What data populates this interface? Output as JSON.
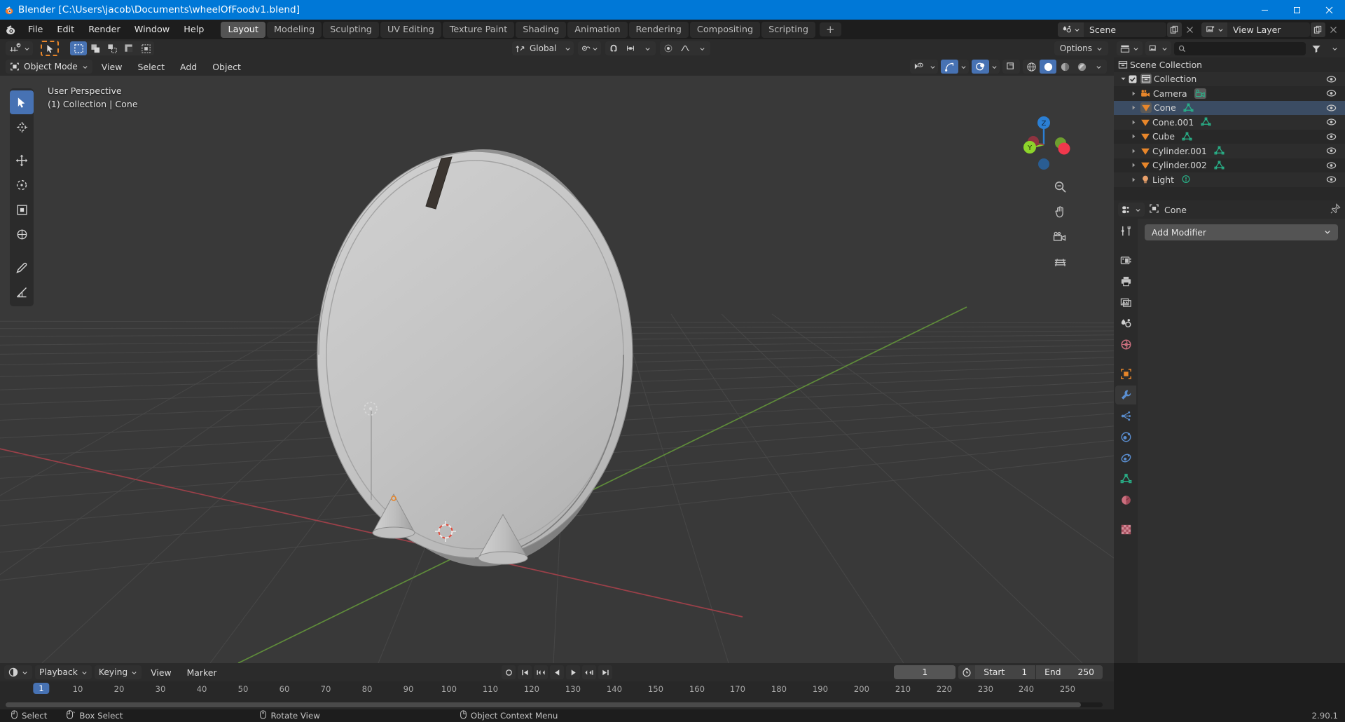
{
  "window": {
    "title": "Blender [C:\\Users\\jacob\\Documents\\wheelOfFoodv1.blend]",
    "minimize": "─",
    "maximize": "☐",
    "close": "✕"
  },
  "topbar": {
    "menus": [
      "File",
      "Edit",
      "Render",
      "Window",
      "Help"
    ],
    "workspaces": [
      {
        "label": "Layout",
        "active": true
      },
      {
        "label": "Modeling",
        "active": false
      },
      {
        "label": "Sculpting",
        "active": false
      },
      {
        "label": "UV Editing",
        "active": false
      },
      {
        "label": "Texture Paint",
        "active": false
      },
      {
        "label": "Shading",
        "active": false
      },
      {
        "label": "Animation",
        "active": false
      },
      {
        "label": "Rendering",
        "active": false
      },
      {
        "label": "Compositing",
        "active": false
      },
      {
        "label": "Scripting",
        "active": false
      }
    ],
    "add_workspace": "+",
    "scene_name": "Scene",
    "view_layer_name": "View Layer"
  },
  "viewport": {
    "orientation_label": "Global",
    "options_label": "Options",
    "mode_label": "Object Mode",
    "header_menus": [
      "View",
      "Select",
      "Add",
      "Object"
    ],
    "overlay_line1": "User Perspective",
    "overlay_line2": "(1) Collection | Cone",
    "gizmo_axes": [
      {
        "label": "Z",
        "color": "#2b7fd4"
      },
      {
        "label": "Y",
        "color": "#8dd42b"
      },
      {
        "label": "X",
        "color": "#d4354a"
      }
    ]
  },
  "outliner": {
    "display_mode": "View Layer",
    "search_placeholder": "",
    "root": "Scene Collection",
    "items": [
      {
        "name": "Collection",
        "type": "collection",
        "indent": 1,
        "checkbox": true,
        "expanded": true,
        "selected": false
      },
      {
        "name": "Camera",
        "type": "camera",
        "indent": 2,
        "selected": false
      },
      {
        "name": "Cone",
        "type": "mesh",
        "indent": 2,
        "selected": true
      },
      {
        "name": "Cone.001",
        "type": "mesh",
        "indent": 2,
        "selected": false
      },
      {
        "name": "Cube",
        "type": "mesh",
        "indent": 2,
        "selected": false
      },
      {
        "name": "Cylinder.001",
        "type": "mesh",
        "indent": 2,
        "selected": false
      },
      {
        "name": "Cylinder.002",
        "type": "mesh",
        "indent": 2,
        "selected": false
      },
      {
        "name": "Light",
        "type": "light",
        "indent": 2,
        "selected": false
      }
    ]
  },
  "properties": {
    "breadcrumb_object": "Cone",
    "add_modifier_label": "Add Modifier",
    "tabs": [
      {
        "name": "tool",
        "active": false
      },
      {
        "name": "render",
        "active": false
      },
      {
        "name": "output",
        "active": false
      },
      {
        "name": "view-layer",
        "active": false
      },
      {
        "name": "scene",
        "active": false
      },
      {
        "name": "world",
        "active": false
      },
      {
        "name": "object",
        "active": false
      },
      {
        "name": "modifier",
        "active": true
      },
      {
        "name": "particles",
        "active": false
      },
      {
        "name": "physics",
        "active": false
      },
      {
        "name": "constraints",
        "active": false
      },
      {
        "name": "object-data",
        "active": false
      },
      {
        "name": "material",
        "active": false
      },
      {
        "name": "texture",
        "active": false
      }
    ]
  },
  "timeline": {
    "menus": [
      "Playback",
      "Keying",
      "View",
      "Marker"
    ],
    "current_frame": "1",
    "start_label": "Start",
    "start_value": "1",
    "end_label": "End",
    "end_value": "250",
    "ticks": [
      "1",
      "10",
      "20",
      "30",
      "40",
      "50",
      "60",
      "70",
      "80",
      "90",
      "100",
      "110",
      "120",
      "130",
      "140",
      "150",
      "160",
      "170",
      "180",
      "190",
      "200",
      "210",
      "220",
      "230",
      "240",
      "250"
    ]
  },
  "statusbar": {
    "items": [
      {
        "label": "Select",
        "icon": "mouse-left"
      },
      {
        "label": "Box Select",
        "icon": "mouse-left-drag"
      },
      {
        "label": "Rotate View",
        "icon": "mouse-middle"
      },
      {
        "label": "Object Context Menu",
        "icon": "mouse-right"
      }
    ],
    "version": "2.90.1"
  },
  "colors": {
    "accent_blue": "#4772b3",
    "title_blue": "#0078d7",
    "orange": "#e8862a",
    "green_mesh": "#29b38a",
    "viewport_bg": "#393939"
  }
}
